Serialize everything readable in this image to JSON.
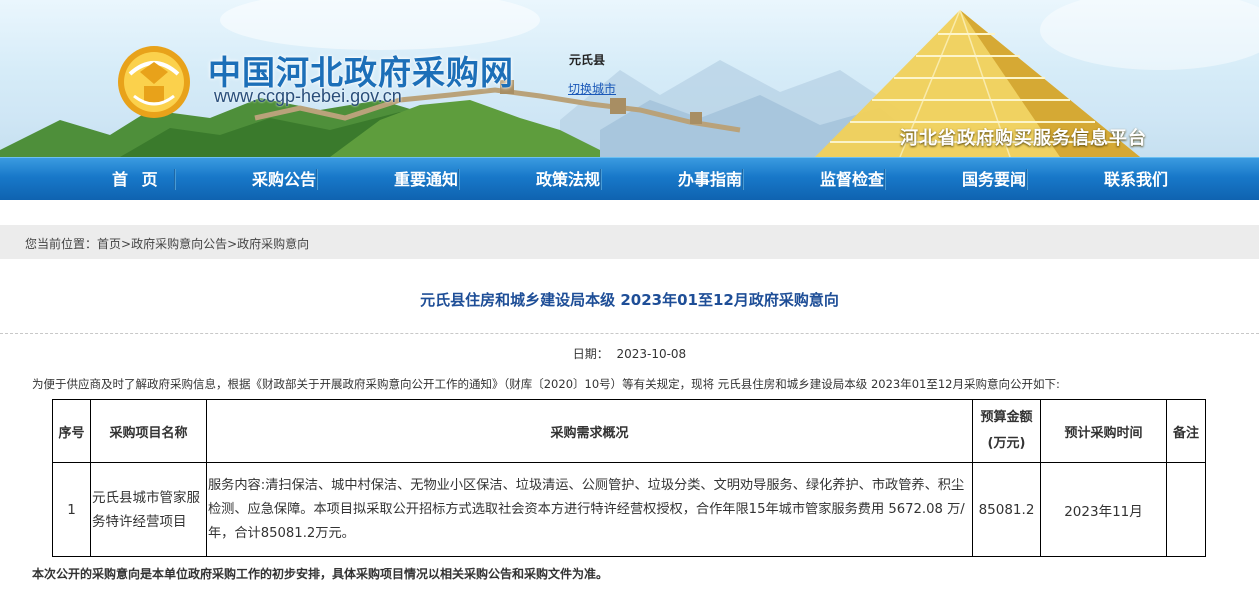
{
  "header": {
    "site_name": "中国河北政府采购网",
    "site_url": "www.ccgp-hebei.gov.cn",
    "county": "元氏县",
    "switch_city": "切换城市",
    "platform_name": "河北省政府购买服务信息平台"
  },
  "nav": {
    "items": [
      {
        "label": "首 页"
      },
      {
        "label": "采购公告"
      },
      {
        "label": "重要通知"
      },
      {
        "label": "政策法规"
      },
      {
        "label": "办事指南"
      },
      {
        "label": "监督检查"
      },
      {
        "label": "国务要闻"
      },
      {
        "label": "联系我们"
      }
    ]
  },
  "breadcrumb": {
    "prefix": "您当前位置：",
    "home": "首页",
    "sep": ">",
    "level1": "政府采购意向公告",
    "level2": "政府采购意向"
  },
  "article": {
    "title": "元氏县住房和城乡建设局本级 2023年01至12月政府采购意向",
    "date_label": "日期：",
    "date_value": "2023-10-08",
    "intro": "为便于供应商及时了解政府采购信息，根据《财政部关于开展政府采购意向公开工作的通知》（财库〔2020〕10号）等有关规定，现将 元氏县住房和城乡建设局本级 2023年01至12月采购意向公开如下:",
    "table": {
      "headers": {
        "num": "序号",
        "name": "采购项目名称",
        "desc": "采购需求概况",
        "amount_line1": "预算金额",
        "amount_line2": "(万元)",
        "time": "预计采购时间",
        "note": "备注"
      },
      "rows": [
        {
          "num": "1",
          "name": "元氏县城市管家服务特许经营项目",
          "desc": "服务内容:清扫保洁、城中村保洁、无物业小区保洁、垃圾清运、公厕管护、垃圾分类、文明劝导服务、绿化养护、市政管养、积尘检测、应急保障。本项目拟采取公开招标方式选取社会资本方进行特许经营权授权，合作年限15年城市管家服务费用 5672.08 万/年，合计85081.2万元。",
          "amount": "85081.2",
          "time": "2023年11月",
          "note": ""
        }
      ]
    },
    "footnote": "本次公开的采购意向是本单位政府采购工作的初步安排，具体采购项目情况以相关采购公告和采购文件为准。"
  },
  "colors": {
    "brand_blue": "#1c6fb8",
    "nav_blue": "#1878c9",
    "title_blue": "#1e4e97",
    "link_blue": "#1a58b8"
  }
}
